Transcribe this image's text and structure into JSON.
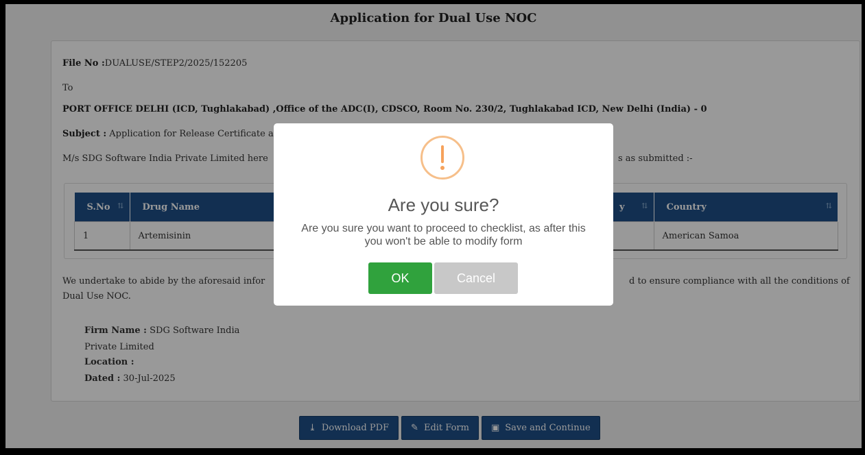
{
  "page": {
    "title": "Application for Dual Use NOC"
  },
  "letter": {
    "file_no_label": "File No :",
    "file_no_value": "DUALUSE/STEP2/2025/152205",
    "to": "To",
    "address": "PORT OFFICE DELHI (ICD, Tughlakabad) ,Office of the ADC(I), CDSCO, Room No. 230/2, Tughlakabad ICD, New Delhi (India) - 0",
    "subject_label": "Subject :",
    "subject_visible": "Application for Release Certificate a",
    "intro_left": "M/s SDG Software India Private Limited here",
    "intro_right": "s as submitted :-"
  },
  "table": {
    "columns": [
      "S.No",
      "Drug Name",
      "y",
      "Country"
    ],
    "rows": [
      [
        "1",
        "Artemisinin",
        "",
        "American Samoa"
      ]
    ]
  },
  "undertaking": {
    "left": "We undertake to abide by the aforesaid infor",
    "right": "d to ensure compliance with all the conditions of",
    "line2": "Dual Use NOC."
  },
  "firm": {
    "name_label": "Firm Name :",
    "name_value_1": "SDG Software India",
    "name_value_2": "Private Limited",
    "location_label": "Location :",
    "dated_label": "Dated :",
    "dated_value": "30-Jul-2025"
  },
  "actions": {
    "download_pdf": "Download PDF",
    "edit_form": "Edit Form",
    "save_continue": "Save and Continue"
  },
  "dialog": {
    "title": "Are you sure?",
    "message": "Are you sure you want to proceed to checklist, as after this you won't be able to modify form",
    "ok": "OK",
    "cancel": "Cancel",
    "icon": "warning-icon",
    "ok_color": "#30a23d",
    "cancel_color": "#c8c8c8"
  }
}
